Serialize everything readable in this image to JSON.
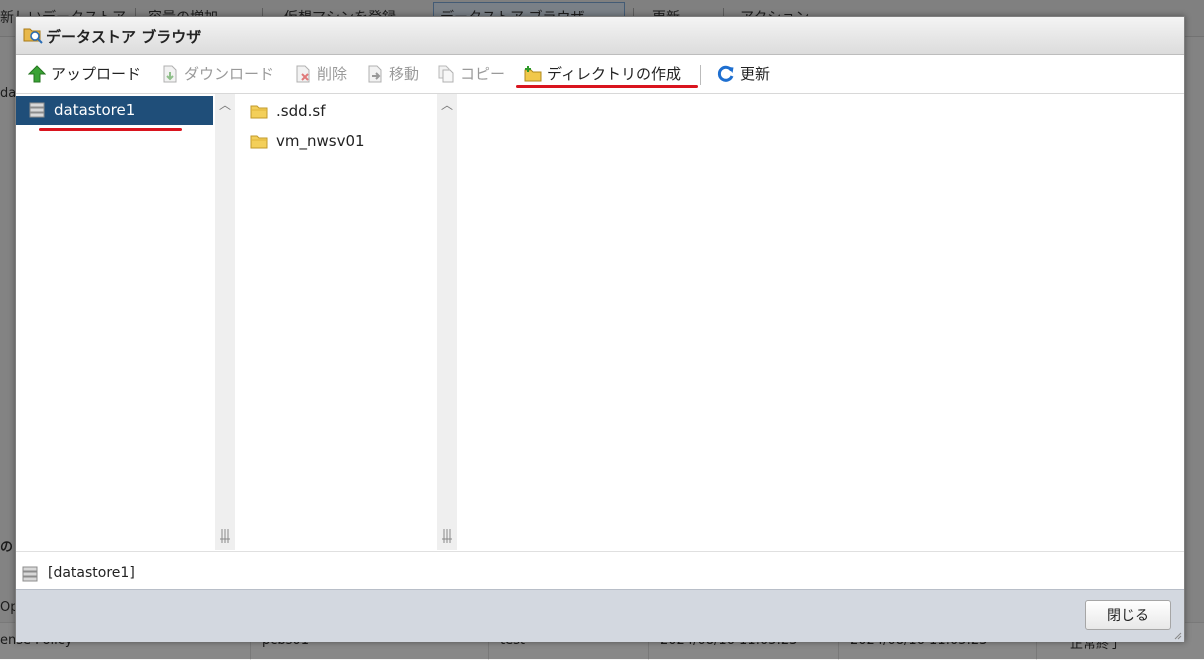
{
  "background_app": {
    "toolbar_items": [
      "新しいデータストア",
      "容量の増加",
      "仮想マシンを登録",
      "データストア ブラウザ",
      "更新",
      "アクション"
    ],
    "side_fragments": [
      "da",
      "の",
      "Opt"
    ],
    "bottom_row": [
      "ense Policy",
      "pcbs01",
      "test",
      "2024/08/16 11:05:23",
      "2024/08/16 11:05:23",
      "正常終了"
    ]
  },
  "dialog": {
    "title": "データストア ブラウザ",
    "toolbar": {
      "upload": "アップロード",
      "download": "ダウンロード",
      "delete": "削除",
      "move": "移動",
      "copy": "コピー",
      "mkdir": "ディレクトリの作成",
      "refresh": "更新"
    },
    "tree": {
      "items": [
        {
          "label": "datastore1",
          "selected": true
        }
      ]
    },
    "files": {
      "items": [
        {
          "label": ".sdd.sf",
          "icon": "folder-icon"
        },
        {
          "label": "vm_nwsv01",
          "icon": "folder-icon"
        }
      ]
    },
    "path": "[datastore1]",
    "close_label": "閉じる"
  },
  "colors": {
    "selection": "#1f4e79",
    "annotation_red": "#d9141e",
    "footer": "#d3d8e0"
  }
}
